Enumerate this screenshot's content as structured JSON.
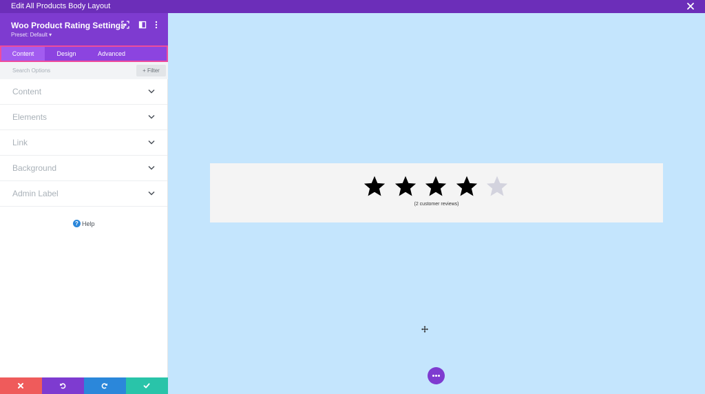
{
  "topbar": {
    "title": "Edit All Products Body Layout",
    "close_icon": "close-icon"
  },
  "panel": {
    "title": "Woo Product Rating Settings",
    "preset": "Preset: Default ▾",
    "header_icons": [
      "expand-icon",
      "sidebar-toggle-icon",
      "more-options-icon"
    ],
    "tabs": [
      {
        "label": "Content",
        "active": true
      },
      {
        "label": "Design",
        "active": false
      },
      {
        "label": "Advanced",
        "active": false
      }
    ],
    "search": {
      "placeholder": "Search Options",
      "filter_label": "+ Filter"
    },
    "sections": [
      {
        "label": "Content"
      },
      {
        "label": "Elements"
      },
      {
        "label": "Link"
      },
      {
        "label": "Background"
      },
      {
        "label": "Admin Label"
      }
    ],
    "help_label": "Help",
    "actions": [
      {
        "name": "discard",
        "icon": "close-icon",
        "color": "#ef5b5b"
      },
      {
        "name": "undo",
        "icon": "undo-icon",
        "color": "#7e3bd0"
      },
      {
        "name": "redo",
        "icon": "redo-icon",
        "color": "#2b87da"
      },
      {
        "name": "save",
        "icon": "check-icon",
        "color": "#29c4a9"
      }
    ]
  },
  "canvas": {
    "background": "#c4e5fd",
    "rating": {
      "filled": 4,
      "total": 5
    },
    "reviews_text": "(2 customer reviews)",
    "fab_icon": "more-dots-icon"
  },
  "colors": {
    "accent": "#7e3bd0",
    "tab_outline": "#ee4c9c",
    "star_filled": "#000000",
    "star_empty": "#d3d3de"
  }
}
